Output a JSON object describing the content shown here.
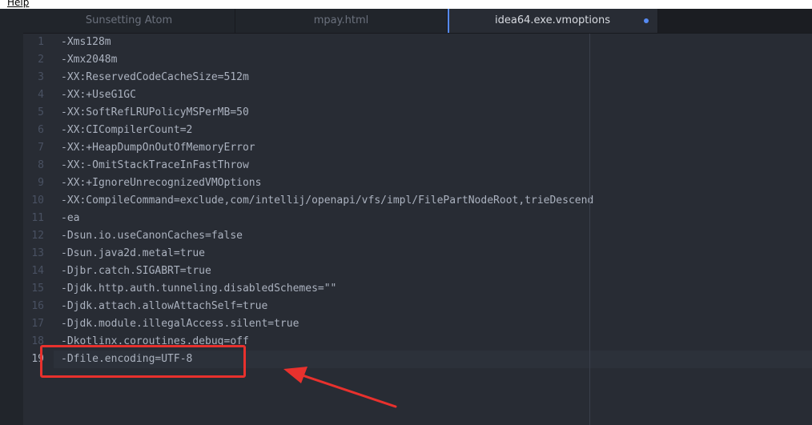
{
  "menubar": {
    "help_label": "Help"
  },
  "tabs": [
    {
      "label": "Sunsetting Atom",
      "active": false
    },
    {
      "label": "mpay.html",
      "active": false
    },
    {
      "label": "idea64.exe.vmoptions",
      "active": true,
      "modified": true
    }
  ],
  "editor": {
    "cursor_line": 19,
    "lines": [
      {
        "num": "1",
        "text": "-Xms128m"
      },
      {
        "num": "2",
        "text": "-Xmx2048m"
      },
      {
        "num": "3",
        "text": "-XX:ReservedCodeCacheSize=512m"
      },
      {
        "num": "4",
        "text": "-XX:+UseG1GC"
      },
      {
        "num": "5",
        "text": "-XX:SoftRefLRUPolicyMSPerMB=50"
      },
      {
        "num": "6",
        "text": "-XX:CICompilerCount=2"
      },
      {
        "num": "7",
        "text": "-XX:+HeapDumpOnOutOfMemoryError"
      },
      {
        "num": "8",
        "text": "-XX:-OmitStackTraceInFastThrow"
      },
      {
        "num": "9",
        "text": "-XX:+IgnoreUnrecognizedVMOptions"
      },
      {
        "num": "10",
        "text": "-XX:CompileCommand=exclude,com/intellij/openapi/vfs/impl/FilePartNodeRoot,trieDescend"
      },
      {
        "num": "11",
        "text": "-ea"
      },
      {
        "num": "12",
        "text": "-Dsun.io.useCanonCaches=false"
      },
      {
        "num": "13",
        "text": "-Dsun.java2d.metal=true"
      },
      {
        "num": "14",
        "text": "-Djbr.catch.SIGABRT=true"
      },
      {
        "num": "15",
        "text": "-Djdk.http.auth.tunneling.disabledSchemes=\"\""
      },
      {
        "num": "16",
        "text": "-Djdk.attach.allowAttachSelf=true"
      },
      {
        "num": "17",
        "text": "-Djdk.module.illegalAccess.silent=true"
      },
      {
        "num": "18",
        "text": "-Dkotlinx.coroutines.debug=off"
      },
      {
        "num": "19",
        "text": "-Dfile.encoding=UTF-8"
      }
    ]
  },
  "colors": {
    "annotation": "#e8312d",
    "accent": "#568af2"
  }
}
